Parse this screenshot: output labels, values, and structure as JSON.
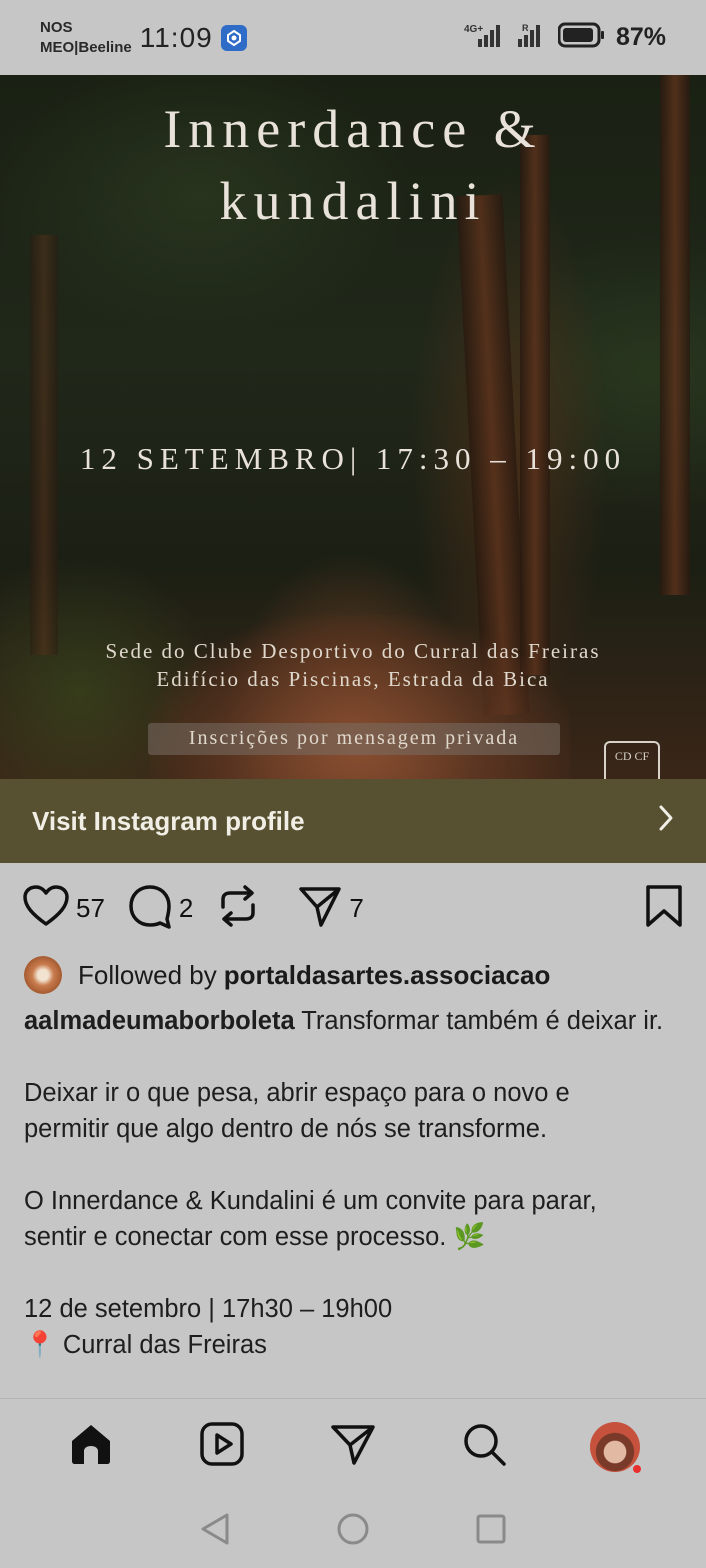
{
  "status_bar": {
    "carrier_1": "NOS",
    "carrier_2": "MEO|Beeline",
    "time": "11:09",
    "battery": "87%",
    "network_1": "4G+",
    "network_2": "R"
  },
  "post_image": {
    "title_line1": "Innerdance &",
    "title_line2": "kundalini",
    "date_time": "12 SETEMBRO| 17:30 – 19:00",
    "venue_line1": "Sede do Clube Desportivo do Curral das Freiras",
    "venue_line2": "Edifício das Piscinas, Estrada da Bica",
    "signup": "Inscrições por mensagem privada",
    "logo_text": "CD CF"
  },
  "visit_banner": {
    "label": "Visit Instagram profile"
  },
  "actions": {
    "likes": "57",
    "comments": "2",
    "shares": "7"
  },
  "followed_by": {
    "prefix": "Followed by",
    "account": "portaldasartes.associacao"
  },
  "caption": {
    "username": "aalmadeumaborboleta",
    "first_text": "Transformar também é deixar ir.",
    "para2_line1": "Deixar ir o que pesa, abrir espaço para o novo e",
    "para2_line2": "permitir que algo dentro de nós se transforme.",
    "para3_line1": "O Innerdance & Kundalini é um convite para parar,",
    "para3_line2": "sentir e conectar com esse processo. 🌿",
    "para4_line1": "12 de setembro | 17h30 – 19h00",
    "para4_line2": "📍 Curral das Freiras"
  },
  "colors": {
    "banner": "#575131",
    "background": "#c6c6c6",
    "notification_dot": "#e8312f"
  },
  "icons": [
    "home-icon",
    "reels-icon",
    "direct-icon",
    "search-icon",
    "profile-avatar"
  ]
}
